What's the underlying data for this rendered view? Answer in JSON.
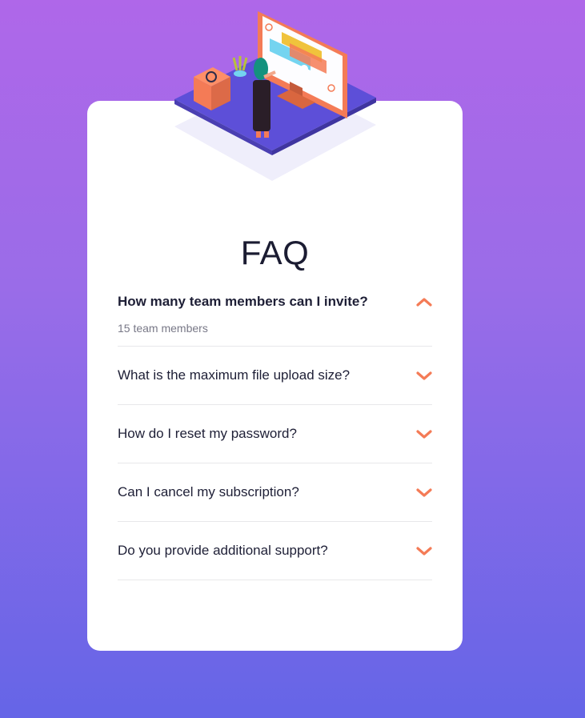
{
  "faq": {
    "title": "FAQ",
    "items": [
      {
        "question": "How many team members can I invite?",
        "answer": "15 team members",
        "open": true
      },
      {
        "question": "What is the maximum file upload size?",
        "open": false
      },
      {
        "question": "How do I reset my password?",
        "open": false
      },
      {
        "question": "Can I cancel my subscription?",
        "open": false
      },
      {
        "question": "Do you provide additional support?",
        "open": false
      }
    ]
  },
  "colors": {
    "accent": "#f47b56",
    "background_top": "#af67e9",
    "background_bottom": "#6565e7",
    "card": "#ffffff"
  },
  "icons": {
    "expanded": "chevron-up-icon",
    "collapsed": "chevron-down-icon"
  }
}
